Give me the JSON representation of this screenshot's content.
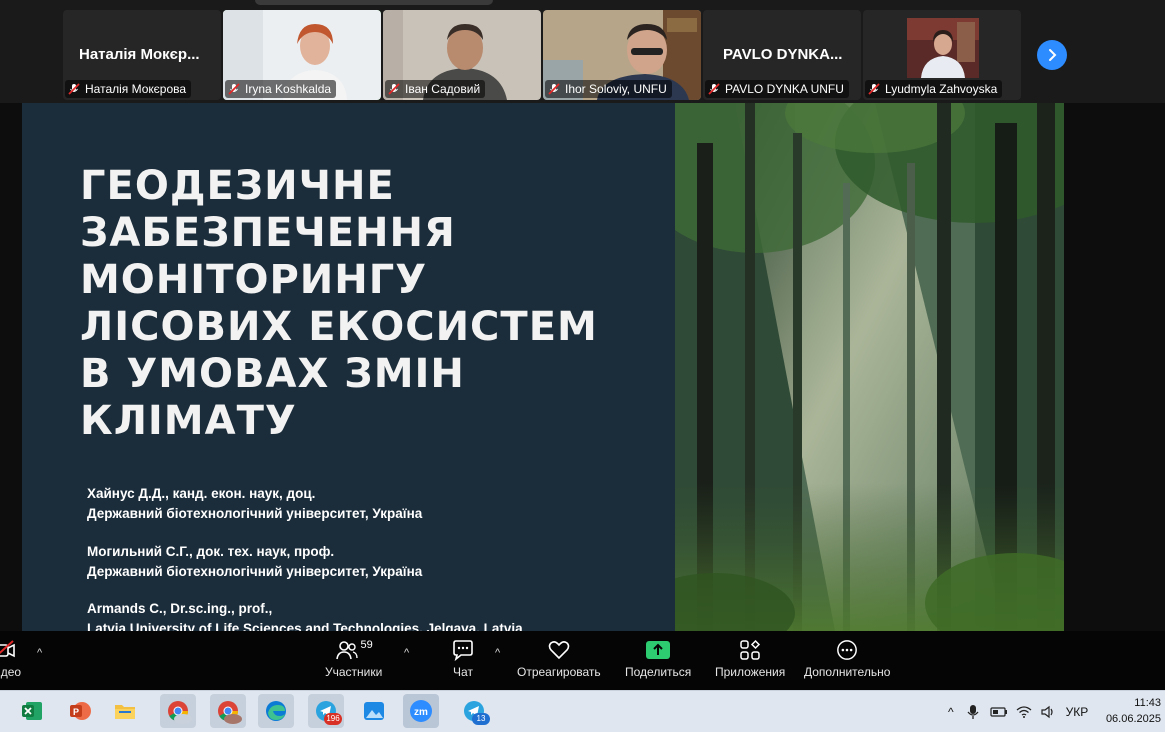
{
  "participants": [
    {
      "name": "Наталія Мокєрова",
      "big_label": "Наталія Мокєр...",
      "video": false,
      "muted": true
    },
    {
      "name": "Iryna Koshkalda",
      "video": true,
      "muted": true,
      "active_speaker": true
    },
    {
      "name": "Іван Садовий",
      "video": true,
      "muted": true
    },
    {
      "name": "Ihor Soloviy, UNFU",
      "video": true,
      "muted": true
    },
    {
      "name": "PAVLO DYNKA  UNFU",
      "big_label": "PAVLO DYNKA...",
      "video": false,
      "muted": true
    },
    {
      "name": "Lyudmyla Zahvoyska",
      "video": true,
      "muted": true
    }
  ],
  "slide": {
    "title_lines": [
      "ГЕОДЕЗИЧНЕ",
      "ЗАБЕЗПЕЧЕННЯ",
      "МОНІТОРИНГУ",
      "ЛІСОВИХ ЕКОСИСТЕМ",
      "В УМОВАХ ЗМІН",
      "КЛІМАТУ"
    ],
    "authors": [
      {
        "line1": "Хайнус Д.Д., канд. екон. наук, доц.",
        "line2": "Державний біотехнологічний університет, Україна"
      },
      {
        "line1": "Могильний С.Г., док. тех. наук, проф.",
        "line2": "Державний біотехнологічний університет, Україна"
      },
      {
        "line1": "Armands C., Dr.sc.ing., prof.,",
        "line2": "Latvia University of Life Sciences and Technologies, Jelgava, Latvia"
      }
    ]
  },
  "toolbar": {
    "video_label": "Видео",
    "participants_label": "Участники",
    "participants_count": "59",
    "chat_label": "Чат",
    "react_label": "Отреагировать",
    "share_label": "Поделиться",
    "apps_label": "Приложения",
    "more_label": "Дополнительно"
  },
  "taskbar": {
    "telegram_badge": "196",
    "telegram2_badge": "13",
    "zoom_text": "zm",
    "language": "УКР",
    "time": "11:43",
    "date": "06.06.2025"
  },
  "colors": {
    "slide_bg": "#1b2c3a",
    "active_border": "#3ec35b",
    "share_green": "#2ecc71",
    "next_button": "#2d8cff"
  }
}
